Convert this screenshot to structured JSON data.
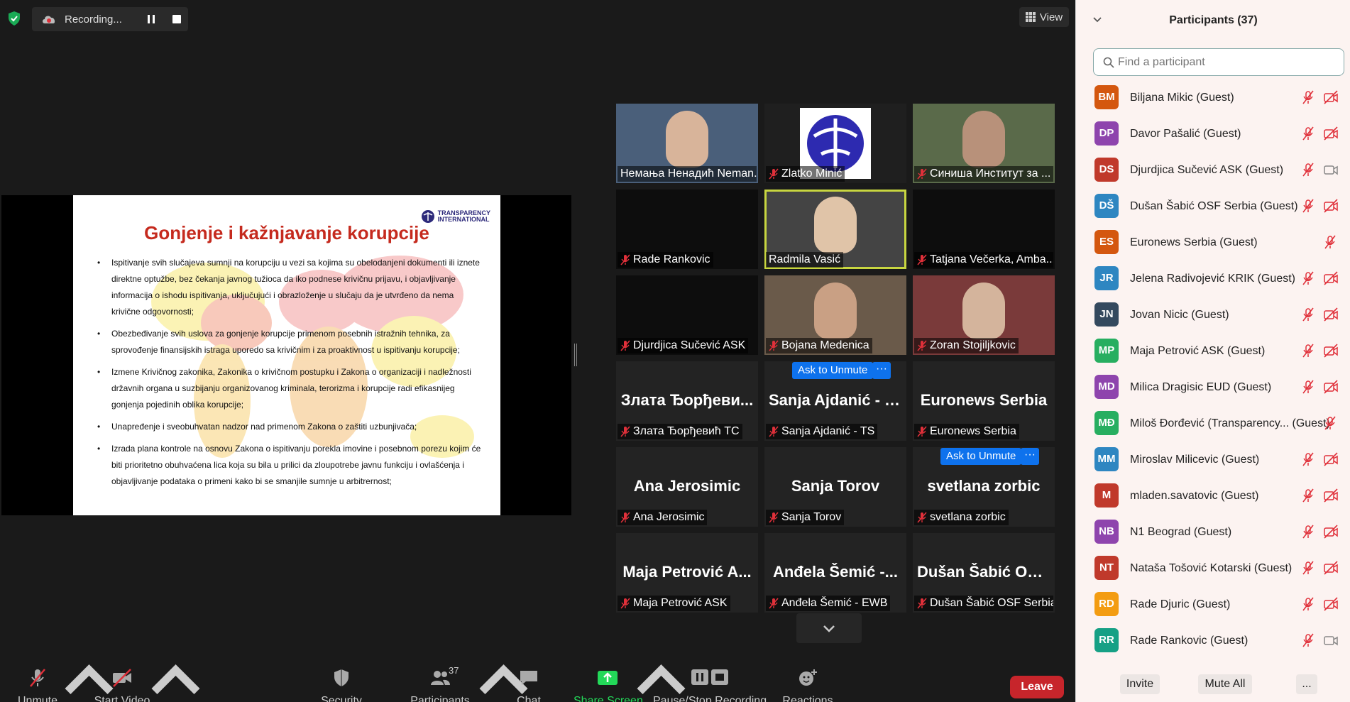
{
  "top": {
    "recording": "Recording...",
    "view": "View"
  },
  "slide": {
    "title": "Gonjenje i kažnjavanje korupcije",
    "logo": [
      "TRANSPARENCY",
      "INTERNATIONAL"
    ],
    "bullets": [
      "Ispitivanje svih slučajeva sumnji na korupciju u vezi sa kojima su obelodanjeni dokumenti ili iznete direktne optužbe, bez čekanja javnog tužioca da iko podnese krivičnu prijavu, i objavljivanje informacija o ishodu ispitivanja, uključujući i obrazloženje u slučaju da je utvrđeno da nema krivične odgovornosti;",
      "Obezbeđivanje svih uslova za gonjenje korupcije primenom posebnih istražnih tehnika, za sprovođenje finansijskih istraga uporedo sa krivičnim i za proaktivnost u ispitivanju korupcije;",
      "Izmene Krivičnog zakonika, Zakonika o krivičnom postupku i Zakona o organizaciji i nadležnosti državnih organa u suzbijanju organizovanog kriminala, terorizma i korupcije radi efikasnijeg gonjenja pojedinih oblika korupcije;",
      "Unapređenje i sveobuhvatan nadzor nad primenom Zakona o zaštiti uzbunjivača;",
      "Izrada plana kontrole na osnovu Zakona o ispitivanju porekla imovine i posebnom porezu kojim će biti prioritetno obuhvaćena lica koja su bila u prilici da zloupotrebe javnu funkciju i ovlašćenja i objavljivanje podataka o primeni kako bi se smanjile sumnje u arbitrernost;"
    ]
  },
  "gallery": [
    {
      "label": "Немања Ненадић Neman...",
      "big": "",
      "muted": false
    },
    {
      "label": "Zlatko Minić",
      "big": "",
      "muted": true
    },
    {
      "label": "Синиша Институт за ...",
      "big": "",
      "muted": true
    },
    {
      "label": "Rade Rankovic",
      "big": "",
      "muted": true
    },
    {
      "label": "Radmila Vasić",
      "big": "",
      "muted": false
    },
    {
      "label": "Tatjana Večerka, Amba...",
      "big": "",
      "muted": true
    },
    {
      "label": "Djurdjica Sučević ASK",
      "big": "",
      "muted": true
    },
    {
      "label": "Bojana Medenica",
      "big": "",
      "muted": true
    },
    {
      "label": "Zoran Stojiljkovic",
      "big": "",
      "muted": true
    },
    {
      "label": "Злата Ђорђевић ТС",
      "big": "Злата Ђорђеви...",
      "muted": true
    },
    {
      "label": "Sanja Ajdanić - TS",
      "big": "Sanja Ajdanić - TS",
      "muted": true
    },
    {
      "label": "Euronews Serbia",
      "big": "Euronews Serbia",
      "muted": true
    },
    {
      "label": "Ana Jerosimic",
      "big": "Ana Jerosimic",
      "muted": true
    },
    {
      "label": "Sanja Torov",
      "big": "Sanja Torov",
      "muted": true
    },
    {
      "label": "svetlana zorbic",
      "big": "svetlana zorbic",
      "muted": true
    },
    {
      "label": "Maja Petrović ASK",
      "big": "Maja Petrović A...",
      "muted": true
    },
    {
      "label": "Anđela Šemić - EWB",
      "big": "Anđela Šemić -...",
      "muted": true
    },
    {
      "label": "Dušan Šabić OSF Serbia",
      "big": "Dušan Šabić OS...",
      "muted": true
    }
  ],
  "ask_to_unmute": "Ask to Unmute",
  "more_dots": "···",
  "toolbar": {
    "unmute": "Unmute",
    "start_video": "Start Video",
    "security": "Security",
    "participants": "Participants",
    "participants_count": "37",
    "chat": "Chat",
    "share_screen": "Share Screen",
    "pause_stop": "Pause/Stop Recording",
    "reactions": "Reactions",
    "leave": "Leave"
  },
  "panel": {
    "title": "Participants (37)",
    "search_placeholder": "Find a participant",
    "invite": "Invite",
    "mute_all": "Mute All",
    "more": "...",
    "participants": [
      {
        "initials": "BM",
        "name": "Biljana Mikic (Guest)",
        "color": "#d4570f",
        "cam": "off"
      },
      {
        "initials": "DP",
        "name": "Davor Pašalić (Guest)",
        "color": "#8e44ad",
        "cam": "off"
      },
      {
        "initials": "DS",
        "name": "Djurdjica Sučević ASK (Guest)",
        "color": "#c0392b",
        "cam": "on"
      },
      {
        "initials": "DŠ",
        "name": "Dušan Šabić OSF Serbia (Guest)",
        "color": "#2e86c1",
        "cam": "off"
      },
      {
        "initials": "ES",
        "name": "Euronews Serbia (Guest)",
        "color": "#d4570f",
        "cam": "none"
      },
      {
        "initials": "JR",
        "name": "Jelena Radivojević KRIK (Guest)",
        "color": "#2e86c1",
        "cam": "off"
      },
      {
        "initials": "JN",
        "name": "Jovan Nicic (Guest)",
        "color": "#34495e",
        "cam": "off"
      },
      {
        "initials": "MP",
        "name": "Maja Petrović ASK (Guest)",
        "color": "#27ae60",
        "cam": "off"
      },
      {
        "initials": "MD",
        "name": "Milica Dragisic EUD (Guest)",
        "color": "#8e44ad",
        "cam": "off"
      },
      {
        "initials": "MĐ",
        "name": "Miloš Đorđević (Transparency... (Guest)",
        "color": "#27ae60",
        "cam": "none"
      },
      {
        "initials": "MM",
        "name": "Miroslav Milicevic (Guest)",
        "color": "#2e86c1",
        "cam": "off"
      },
      {
        "initials": "M",
        "name": "mladen.savatovic (Guest)",
        "color": "#c0392b",
        "cam": "off"
      },
      {
        "initials": "NB",
        "name": "N1 Beograd (Guest)",
        "color": "#8e44ad",
        "cam": "off"
      },
      {
        "initials": "NT",
        "name": "Nataša Tošović Kotarski (Guest)",
        "color": "#c0392b",
        "cam": "off"
      },
      {
        "initials": "RD",
        "name": "Rade Djuric (Guest)",
        "color": "#f39c12",
        "cam": "off"
      },
      {
        "initials": "RR",
        "name": "Rade Rankovic (Guest)",
        "color": "#16a085",
        "cam": "on"
      }
    ]
  }
}
